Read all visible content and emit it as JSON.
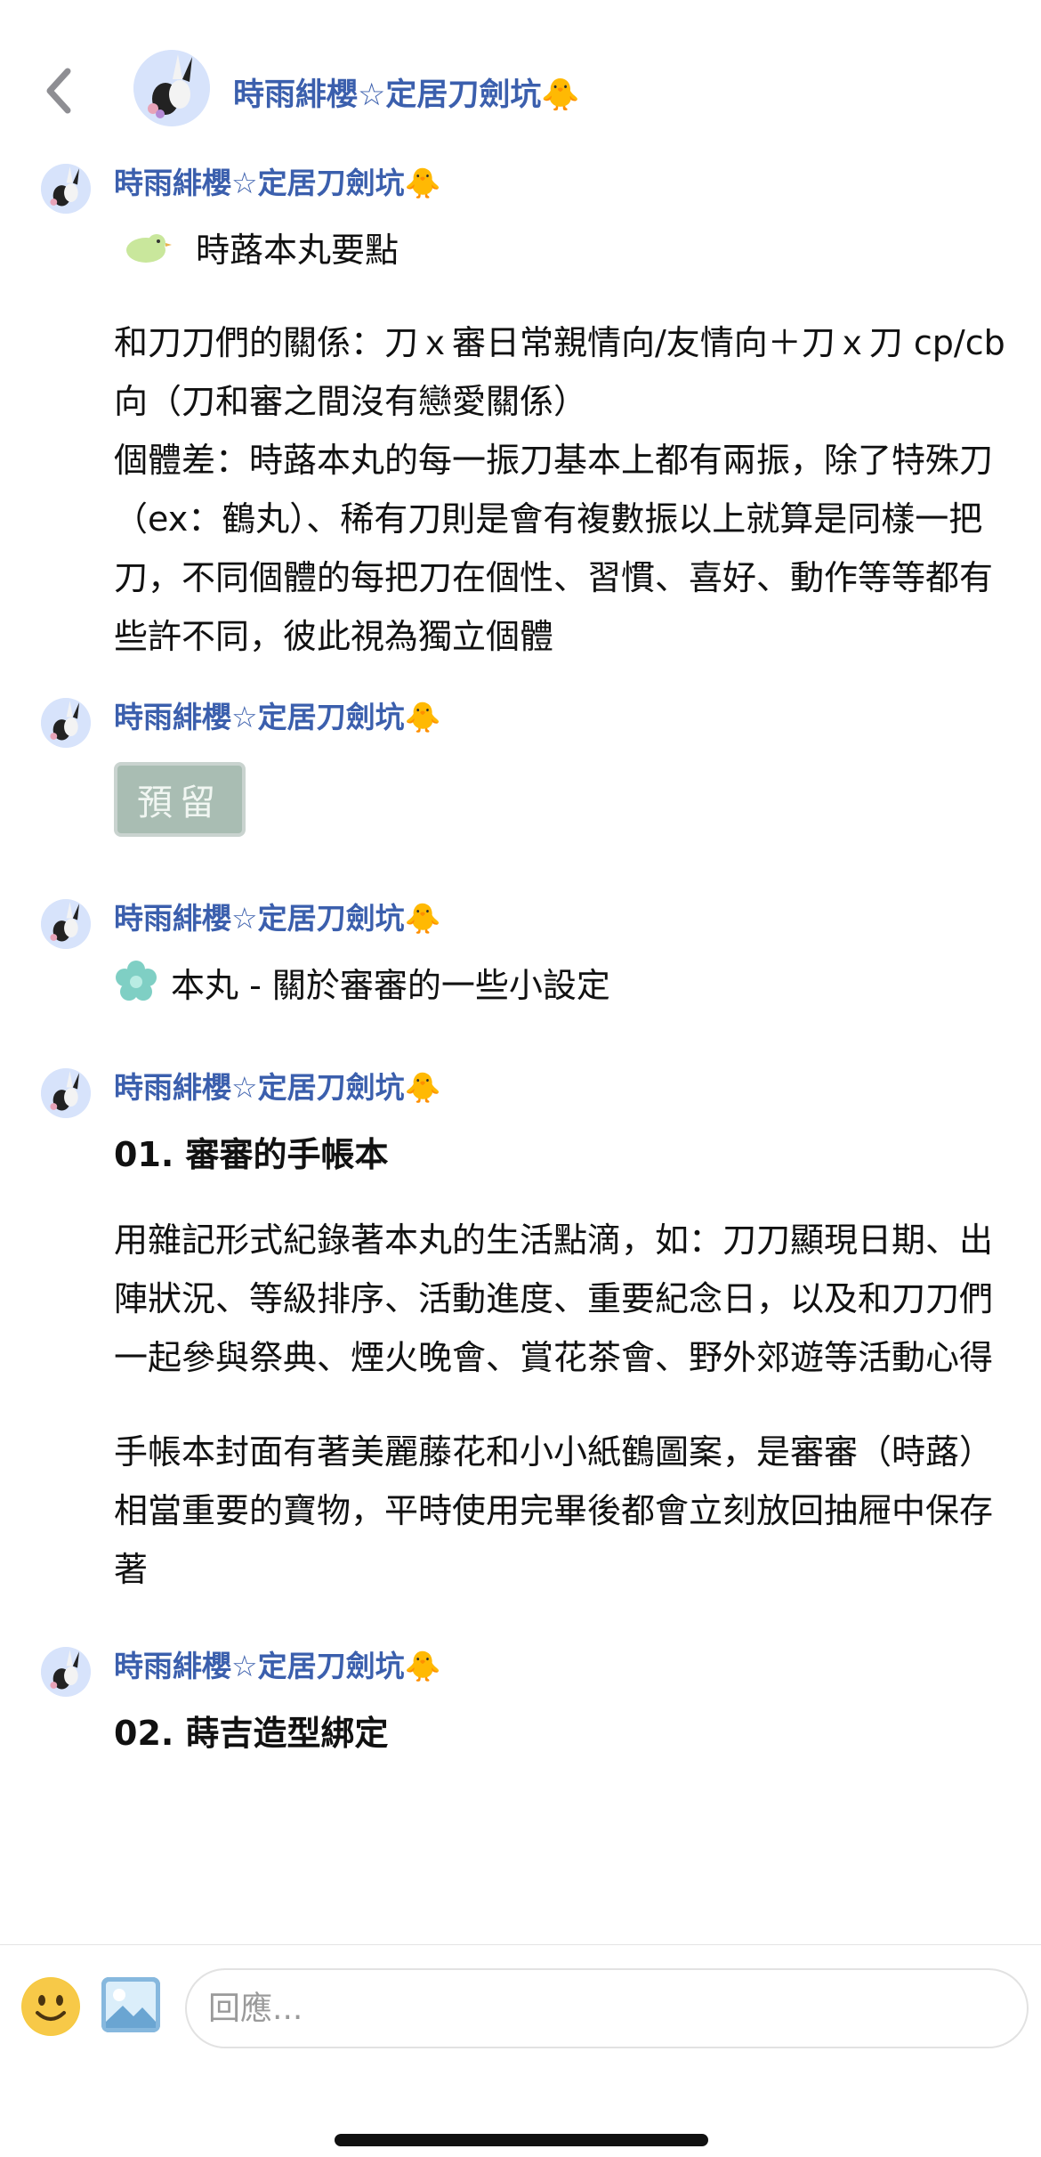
{
  "header": {
    "title": "時雨緋櫻☆定居刀劍坑",
    "title_emoji": "🐥"
  },
  "posts": [
    {
      "author": "時雨緋櫻☆定居刀劍坑",
      "author_emoji": "🐥",
      "heading": "時蕗本丸要點",
      "paragraphs": [
        "和刀刀們的關係：刀ｘ審日常親情向/友情向＋刀ｘ刀 cp/cb向（刀和審之間沒有戀愛關係）",
        "個體差：時蕗本丸的每一振刀基本上都有兩振，除了特殊刀（ex：鶴丸）、稀有刀則是會有複數振以上就算是同樣一把刀，不同個體的每把刀在個性、習慣、喜好、動作等等都有些許不同，彼此視為獨立個體"
      ]
    },
    {
      "author": "時雨緋櫻☆定居刀劍坑",
      "author_emoji": "🐥",
      "sticker_text": "預留"
    },
    {
      "author": "時雨緋櫻☆定居刀劍坑",
      "author_emoji": "🐥",
      "heading": "本丸 - 關於審審的一些小設定"
    },
    {
      "author": "時雨緋櫻☆定居刀劍坑",
      "author_emoji": "🐥",
      "title": "01. 審審的手帳本",
      "paragraphs": [
        "用雜記形式紀錄著本丸的生活點滴，如：刀刀顯現日期、出陣狀況、等級排序、活動進度、重要紀念日，以及和刀刀們一起參與祭典、煙火晚會、賞花茶會、野外郊遊等活動心得",
        "手帳本封面有著美麗藤花和小小紙鶴圖案，是審審（時蕗）相當重要的寶物，平時使用完畢後都會立刻放回抽屜中保存著"
      ]
    },
    {
      "author": "時雨緋櫻☆定居刀劍坑",
      "author_emoji": "🐥",
      "title": "02. 蒔吉造型綁定"
    }
  ],
  "composer": {
    "placeholder": "回應..."
  },
  "icons": [
    "back-chevron-icon",
    "avatar-icon",
    "chick-emoji-icon",
    "green-bird-icon",
    "teal-flower-icon",
    "emoji-icon",
    "photo-icon"
  ]
}
